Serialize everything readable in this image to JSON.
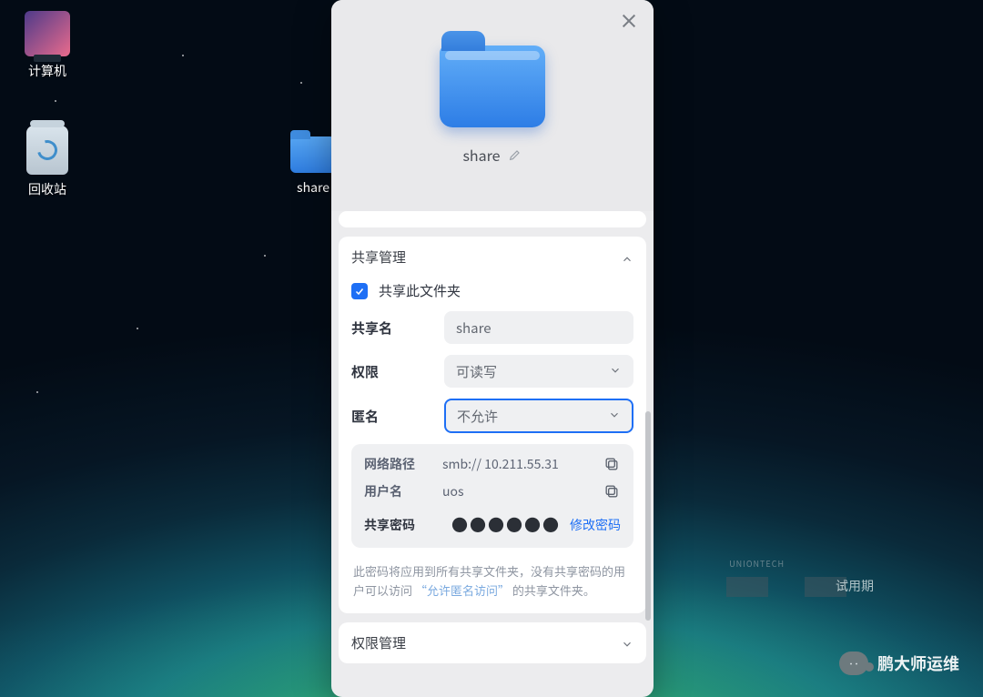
{
  "desktop": {
    "computer_label": "计算机",
    "trash_label": "回收站",
    "share_folder_label": "share"
  },
  "dialog": {
    "folder_name": "share",
    "sections": {
      "share_mgmt_title": "共享管理",
      "perm_mgmt_title": "权限管理"
    },
    "share": {
      "checkbox_label": "共享此文件夹",
      "name_label": "共享名",
      "name_value": "share",
      "perm_label": "权限",
      "perm_value": "可读写",
      "anon_label": "匿名",
      "anon_value": "不允许"
    },
    "info": {
      "network_path_label": "网络路径",
      "network_path_value": "smb:// 10.211.55.31",
      "username_label": "用户名",
      "username_value": "uos",
      "password_label": "共享密码",
      "password_masked": "●●●●●●",
      "change_password_link": "修改密码",
      "hint_prefix": "此密码将应用到所有共享文件夹，没有共享密码的用户可以访问",
      "hint_quoted": "“允许匿名访问”",
      "hint_suffix": "的共享文件夹。"
    }
  },
  "watermark": {
    "trial_text": "试用期",
    "uniontech": "UNIONTECH",
    "brand_text": "鹏大师运维",
    "bubble": "‥"
  }
}
